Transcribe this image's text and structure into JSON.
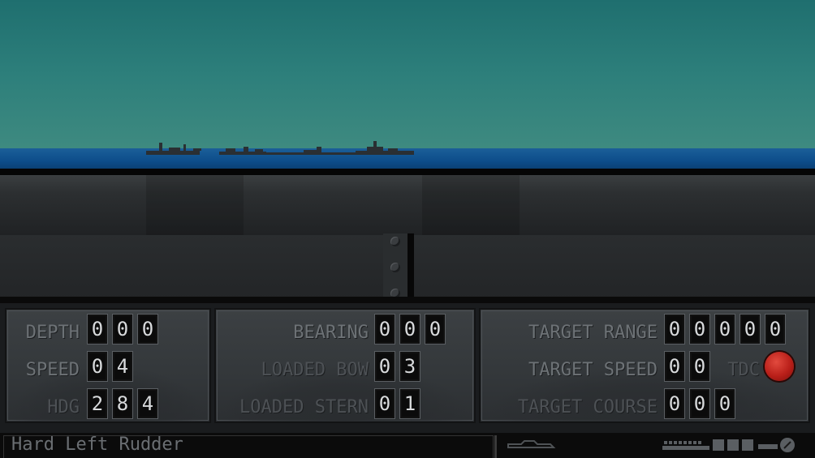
{
  "gauges": {
    "depth": {
      "label": "DEPTH",
      "digits": [
        "0",
        "0",
        "0"
      ]
    },
    "speed": {
      "label": "SPEED",
      "digits": [
        "0",
        "4"
      ]
    },
    "hdg": {
      "label": "HDG",
      "digits": [
        "2",
        "8",
        "4"
      ]
    },
    "bearing": {
      "label": "BEARING",
      "digits": [
        "0",
        "0",
        "0"
      ]
    },
    "loaded_bow": {
      "label": "LOADED BOW",
      "digits": [
        "0",
        "3"
      ]
    },
    "loaded_stern": {
      "label": "LOADED STERN",
      "digits": [
        "0",
        "1"
      ]
    },
    "target_range": {
      "label": "TARGET RANGE",
      "digits": [
        "0",
        "0",
        "0",
        "0",
        "0"
      ]
    },
    "target_speed": {
      "label": "TARGET SPEED",
      "digits": [
        "0",
        "0"
      ]
    },
    "target_course": {
      "label": "TARGET COURSE",
      "digits": [
        "0",
        "0",
        "0"
      ]
    }
  },
  "tdc": {
    "label": "TDC",
    "button_color": "#c0241c"
  },
  "status": {
    "message": "Hard Left Rudder"
  },
  "icons": [
    "submarine-icon",
    "torpedo-indicator-icon",
    "compass-icon"
  ],
  "colors": {
    "sky": "#2d7f7b",
    "sea": "#0d4d8a",
    "panel": "#363a3d",
    "digit_text": "#d8dadc"
  }
}
